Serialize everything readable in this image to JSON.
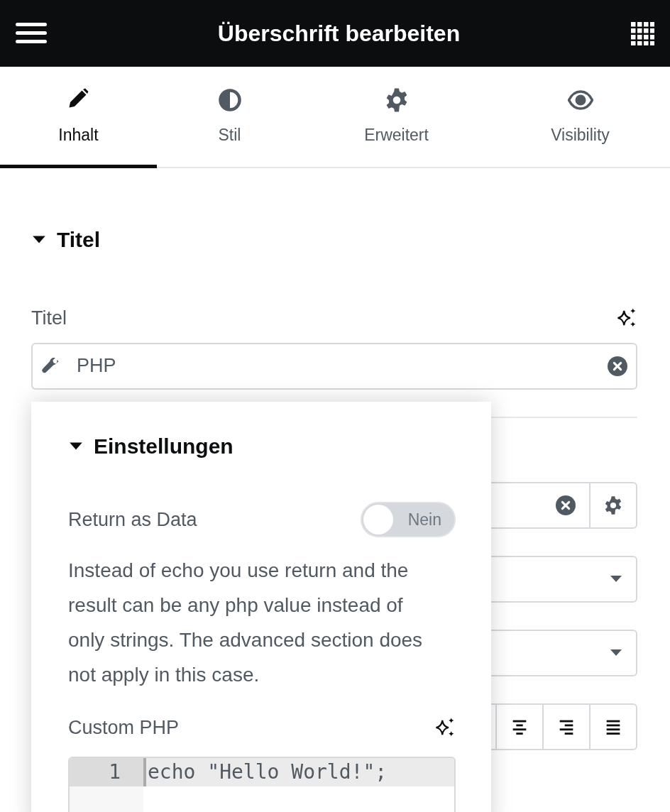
{
  "header": {
    "title": "Überschrift bearbeiten"
  },
  "tabs": [
    {
      "label": "Inhalt",
      "selected": true
    },
    {
      "label": "Stil",
      "selected": false
    },
    {
      "label": "Erweitert",
      "selected": false
    },
    {
      "label": "Visibility",
      "selected": false
    }
  ],
  "section": {
    "title": "Titel",
    "expanded": true
  },
  "title_field": {
    "label": "Titel",
    "value": "PHP"
  },
  "background_controls": [
    {
      "kind": "field"
    },
    {
      "kind": "select"
    },
    {
      "kind": "select"
    },
    {
      "kind": "align",
      "buttons": [
        {
          "kind": "center"
        },
        {
          "kind": "right"
        },
        {
          "kind": "justify"
        }
      ]
    }
  ],
  "popover": {
    "section": {
      "title": "Einstellungen",
      "expanded": true
    },
    "toggle": {
      "label": "Return as Data",
      "on": false,
      "text": "Nein"
    },
    "description": "Instead of echo you use return and the result can be any php value instead of only strings. The advanced section does not apply in this case.",
    "code": {
      "label": "Custom PHP",
      "lines": [
        {
          "number": "1",
          "text": "echo \"Hello World!\";",
          "active": true
        }
      ]
    }
  }
}
